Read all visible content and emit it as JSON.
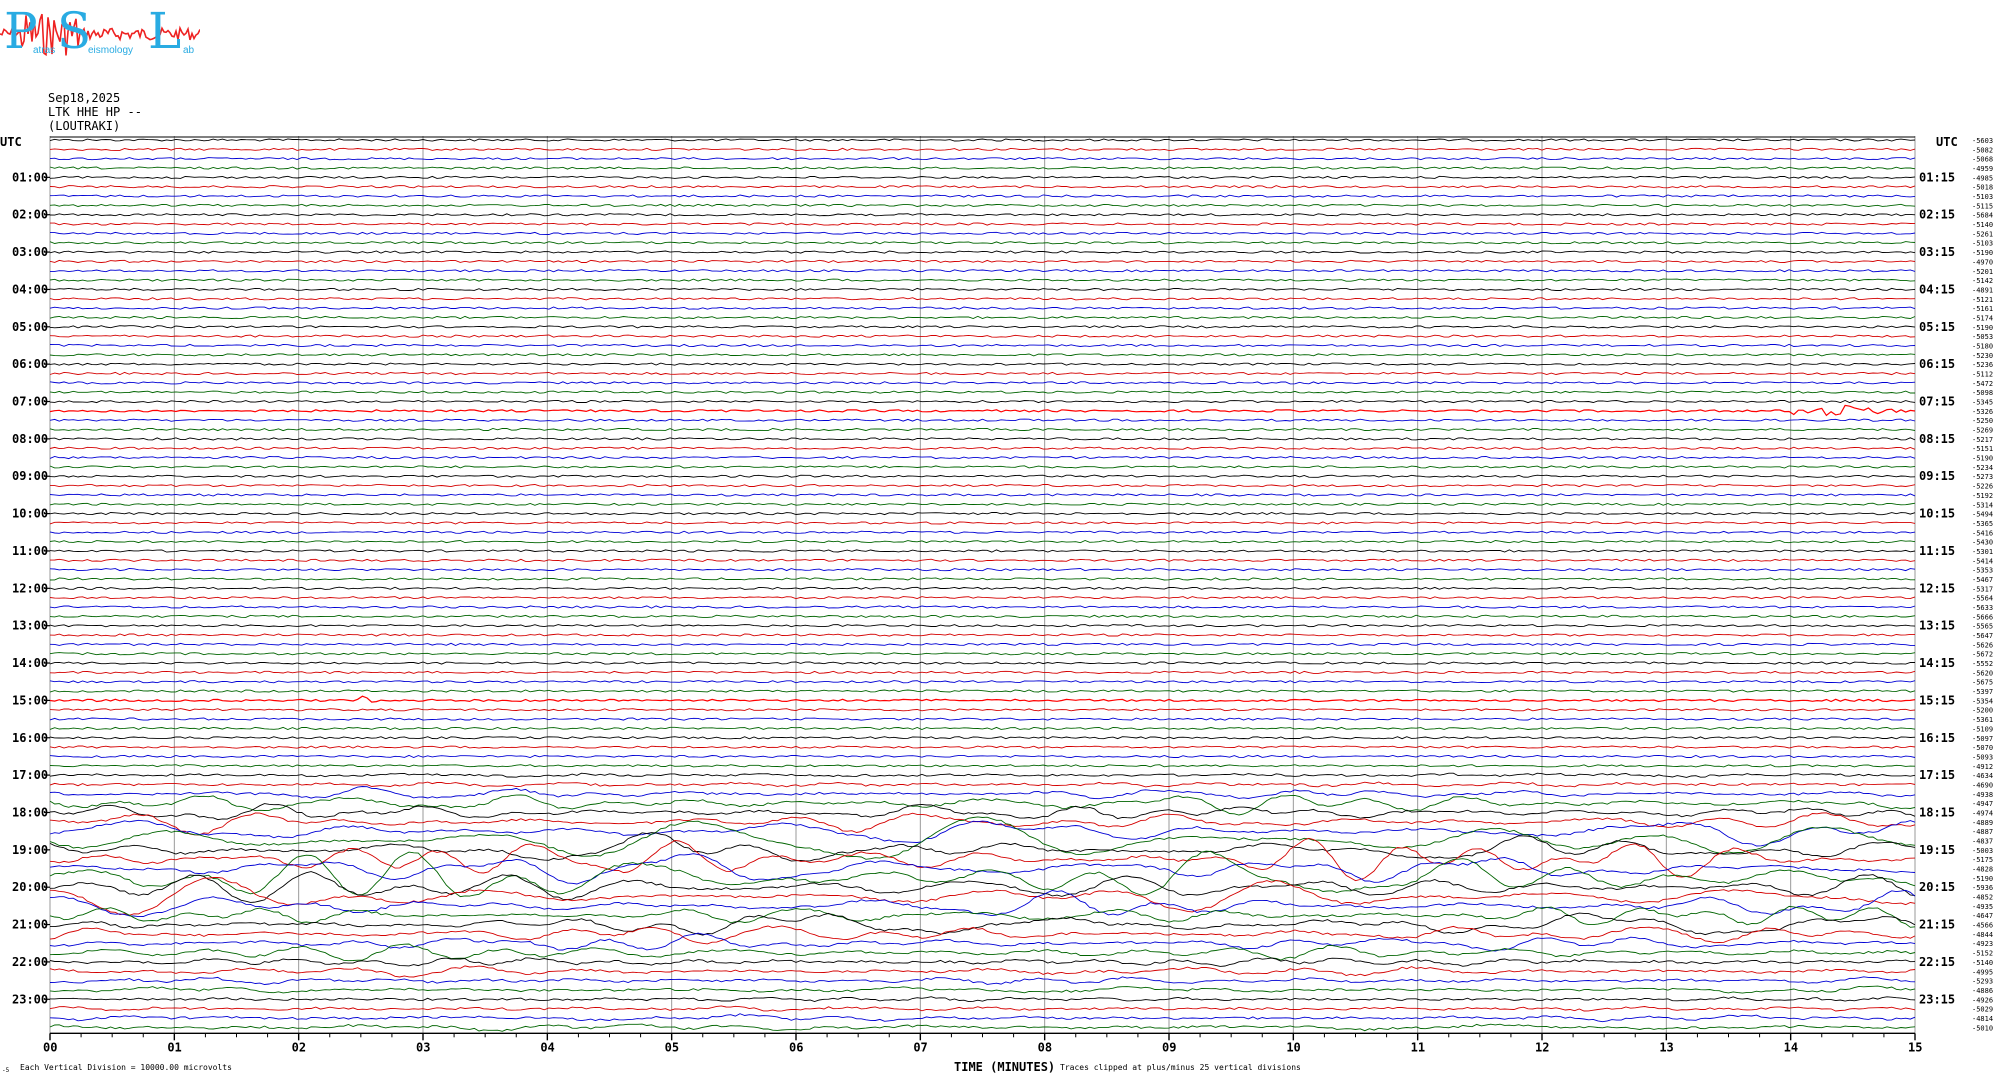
{
  "logo": {
    "letters": [
      "P",
      "S",
      "L"
    ],
    "small_words": [
      "atras",
      "eismology",
      "ab"
    ],
    "text_color": "#29abe2",
    "wave_color": "#ee2222"
  },
  "header": {
    "date": "Sep18,2025",
    "station": "LTK HHE HP --",
    "location": "(LOUTRAKI)"
  },
  "axis": {
    "left_title": "UTC",
    "right_title": "UTC",
    "left_hour_labels": [
      "01:00",
      "02:00",
      "03:00",
      "04:00",
      "05:00",
      "06:00",
      "07:00",
      "08:00",
      "09:00",
      "10:00",
      "11:00",
      "12:00",
      "13:00",
      "14:00",
      "15:00",
      "16:00",
      "17:00",
      "18:00",
      "19:00",
      "20:00",
      "21:00",
      "22:00",
      "23:00"
    ],
    "right_hour_labels": [
      "01:15",
      "02:15",
      "03:15",
      "04:15",
      "05:15",
      "06:15",
      "07:15",
      "08:15",
      "09:15",
      "10:15",
      "11:15",
      "12:15",
      "13:15",
      "14:15",
      "15:15",
      "16:15",
      "17:15",
      "18:15",
      "19:15",
      "20:15",
      "21:15",
      "22:15",
      "23:15"
    ],
    "minute_ticks": [
      "00",
      "01",
      "02",
      "03",
      "04",
      "05",
      "06",
      "07",
      "08",
      "09",
      "10",
      "11",
      "12",
      "13",
      "14",
      "15"
    ],
    "xlabel": "TIME (MINUTES)",
    "scale_note": "Each Vertical Division = 10000.00 microvolts",
    "clip_note": "Traces clipped at plus/minus 25 vertical divisions",
    "corner_mark": "-5"
  },
  "chart_data": {
    "type": "line",
    "title": "",
    "xlabel": "TIME (MINUTES)",
    "ylabel": "UTC",
    "xlim": [
      0,
      15
    ],
    "trace_count": 96,
    "trace_minutes": 15,
    "colors": [
      "#000000",
      "#d40000",
      "#0000d4",
      "#006400"
    ],
    "grid": true,
    "events": [
      {
        "trace": "07:15",
        "minute_start": 14.0,
        "minute_peak": 14.2,
        "label": "local event",
        "amplitude": 10
      },
      {
        "trace": "15:00",
        "minute_start": 2.4,
        "minute_peak": 2.5,
        "label": "small event",
        "amplitude": 5
      }
    ],
    "teleseism": {
      "start_hour": "16:45",
      "peak_hour": "19:30",
      "end_hour": "22:30"
    },
    "right_offsets": [
      "-5603",
      "-5082",
      "-5068",
      "-4959",
      "-4985",
      "-5018",
      "-5103",
      "-5115",
      "-5684",
      "-5140",
      "-5261",
      "-5103",
      "-5190",
      "-4970",
      "-5201",
      "-5142",
      "-4891",
      "-5121",
      "-5161",
      "-5174",
      "-5190",
      "-5053",
      "-5180",
      "-5230",
      "-5236",
      "-5112",
      "-5472",
      "-5098",
      "-5345",
      "-5326",
      "-5250",
      "-5269",
      "-5217",
      "-5151",
      "-5190",
      "-5234",
      "-5273",
      "-5226",
      "-5192",
      "-5314",
      "-5494",
      "-5365",
      "-5416",
      "-5430",
      "-5301",
      "-5414",
      "-5353",
      "-5467",
      "-5317",
      "-5564",
      "-5633",
      "-5666",
      "-5565",
      "-5647",
      "-5626",
      "-5672",
      "-5552",
      "-5620",
      "-5675",
      "-5397",
      "-5354",
      "-5200",
      "-5361",
      "-5109",
      "-5097",
      "-5070",
      "-5093",
      "-4912",
      "-4634",
      "-4690",
      "-4938",
      "-4947",
      "-4974",
      "-4889",
      "-4887",
      "-4837",
      "-5003",
      "-5175",
      "-4828",
      "-5190",
      "-5936",
      "-4852",
      "-4935",
      "-4647",
      "-4566",
      "-4844",
      "-4923",
      "-5152",
      "-5140",
      "-4995",
      "-5293",
      "-4886",
      "-4926",
      "-5029",
      "-4814",
      "-5010"
    ]
  }
}
